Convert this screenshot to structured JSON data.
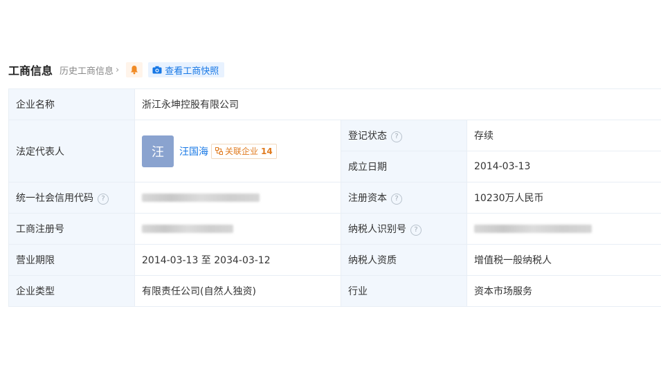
{
  "header": {
    "title": "工商信息",
    "history_link": "历史工商信息",
    "snapshot_button": "查看工商快照",
    "icons": {
      "history_chevron": "chevron-right-icon",
      "bell": "bell-icon",
      "camera": "camera-icon"
    }
  },
  "table": {
    "company_name": {
      "label": "企业名称",
      "value": "浙江永坤控股有限公司"
    },
    "legal_rep": {
      "label": "法定代表人",
      "avatar_char": "汪",
      "name": "汪国海",
      "related_label": "关联企业",
      "related_count": "14"
    },
    "reg_status": {
      "label": "登记状态",
      "value": "存续"
    },
    "established": {
      "label": "成立日期",
      "value": "2014-03-13"
    },
    "credit_code": {
      "label": "统一社会信用代码"
    },
    "reg_capital": {
      "label": "注册资本",
      "value": "10230万人民币"
    },
    "biz_reg_no": {
      "label": "工商注册号"
    },
    "taxpayer_id": {
      "label": "纳税人识别号"
    },
    "biz_term": {
      "label": "营业期限",
      "value": "2014-03-13 至 2034-03-12"
    },
    "taxpayer_qual": {
      "label": "纳税人资质",
      "value": "增值税一般纳税人"
    },
    "company_type": {
      "label": "企业类型",
      "value": "有限责任公司(自然人独资)"
    },
    "industry": {
      "label": "行业",
      "value": "资本市场服务"
    }
  },
  "colors": {
    "accent_blue": "#1677e5",
    "status_green": "#1aa34a",
    "label_bg": "#f2f7fd",
    "badge_orange": "#e07a1e"
  }
}
